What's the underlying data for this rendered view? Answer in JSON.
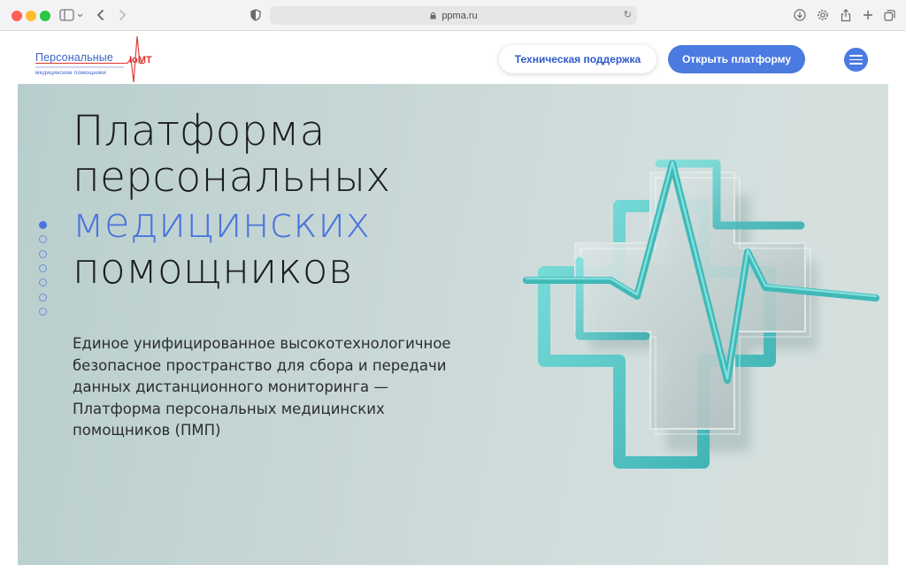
{
  "browser": {
    "url": "ppma.ru",
    "icons": {
      "sidebar": "sidebar-icon",
      "back": "chevron-left-icon",
      "forward": "chevron-right-icon",
      "shield": "shield-icon",
      "reload": "reload-icon",
      "download": "download-icon",
      "settings": "gear-icon",
      "share": "share-icon",
      "new_tab": "plus-icon",
      "tabs": "tabs-icon"
    }
  },
  "header": {
    "logo": {
      "main": "Персональные",
      "sub": "медицинские помощники",
      "badge": "IoMT"
    },
    "support_label": "Техническая поддержка",
    "open_label": "Открыть платформу"
  },
  "hero": {
    "title_lines": [
      "Платформа",
      "персональных",
      "медицинских",
      "помощников"
    ],
    "description": "Единое унифицированное высокотехнологичное безопасное пространство для сбора и передачи данных дистанционного мониторинга — Платформа персональных медицинских помощников (ПМП)",
    "slides_total": 7,
    "slide_active": 1
  },
  "colors": {
    "accent": "#4a74dc",
    "button_blue": "#4b7ae0",
    "logo_red": "#e0322d",
    "hero_bg": "#c6d6d5",
    "teal": "#4bc3c0"
  }
}
